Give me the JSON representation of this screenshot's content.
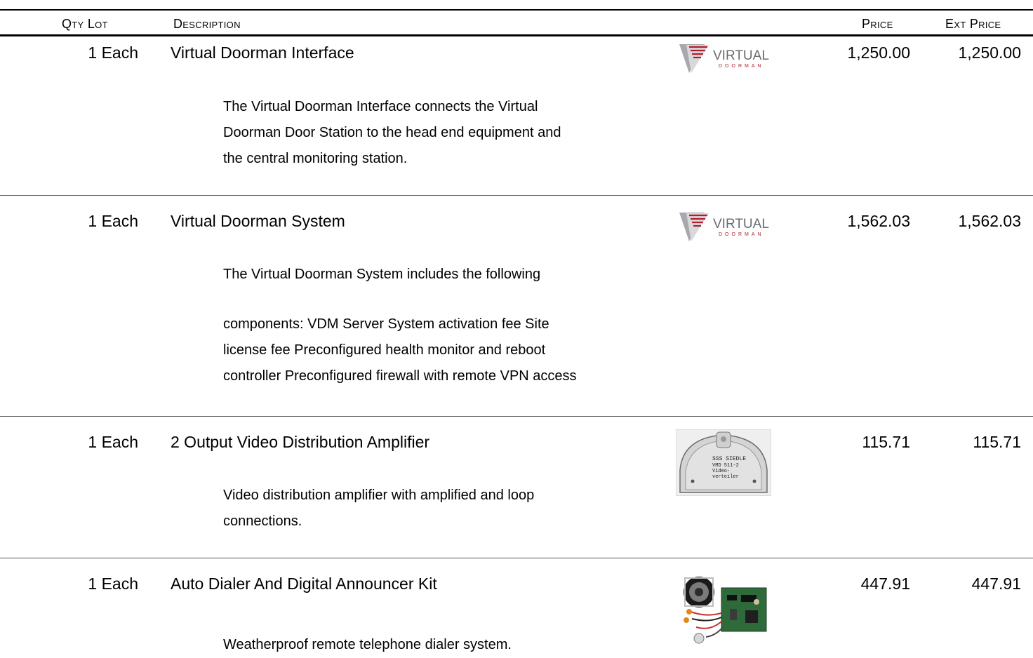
{
  "header": {
    "qty_lot": "Qty Lot",
    "description": "Description",
    "price": "Price",
    "ext_price": "Ext Price"
  },
  "items": [
    {
      "qty": "1 Each",
      "name": "Virtual Doorman Interface",
      "image": "virtual-doorman-logo",
      "logo_text": "VIRTUAL",
      "logo_sub": "DOORMAN",
      "price": "1,250.00",
      "ext_price": "1,250.00",
      "desc_lines": [
        "The Virtual Doorman Interface connects the Virtual",
        "Doorman Door Station to the head end equipment and",
        "the central monitoring station."
      ]
    },
    {
      "qty": "1 Each",
      "name": "Virtual Doorman System",
      "image": "virtual-doorman-logo",
      "logo_text": "VIRTUAL",
      "logo_sub": "DOORMAN",
      "price": "1,562.03",
      "ext_price": "1,562.03",
      "desc_lines_a": [
        "The Virtual Doorman System includes the following"
      ],
      "desc_lines_b": [
        "components: VDM Server System activation fee Site",
        "license fee Preconfigured health monitor and reboot",
        "controller Preconfigured firewall with remote VPN access"
      ]
    },
    {
      "qty": "1 Each",
      "name": "2 Output Video Distribution Amplifier",
      "image": "siedle-amplifier-photo",
      "photo_text": [
        "SSS SIEDLE",
        "VMD 511-2",
        "Video-",
        "verteiler"
      ],
      "price": "115.71",
      "ext_price": "115.71",
      "desc_lines": [
        "Video distribution amplifier with amplified and loop",
        "connections."
      ]
    },
    {
      "qty": "1 Each",
      "name": "Auto Dialer And Digital Announcer Kit",
      "image": "auto-dialer-kit-photo",
      "price": "447.91",
      "ext_price": "447.91",
      "desc_lines": [
        "Weatherproof remote telephone dialer system."
      ]
    }
  ]
}
